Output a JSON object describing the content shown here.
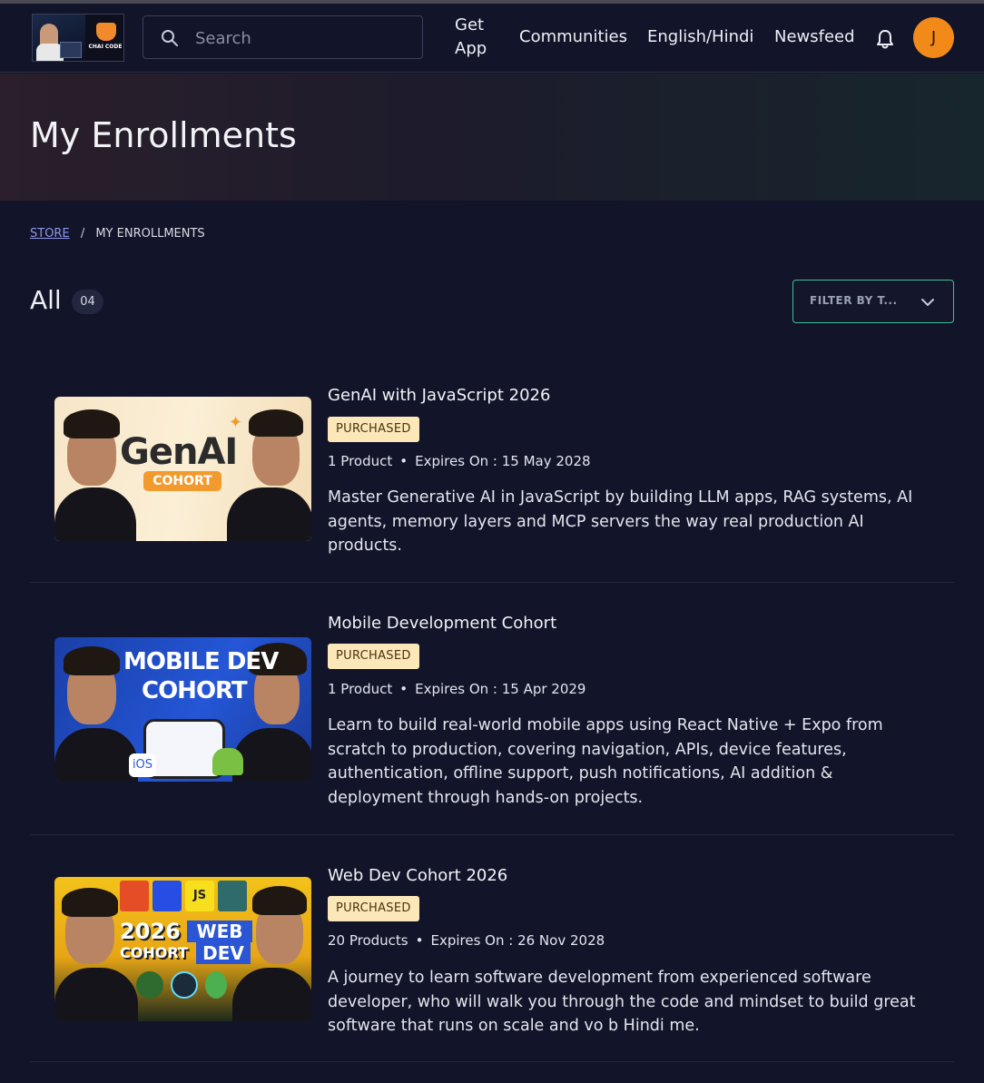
{
  "header": {
    "brand": "CHAI CODE",
    "search_placeholder": "Search",
    "nav": {
      "get_app": "Get App",
      "communities": "Communities",
      "language": "English/Hindi",
      "newsfeed": "Newsfeed"
    },
    "avatar_initial": "J"
  },
  "hero": {
    "title": "My Enrollments"
  },
  "breadcrumb": {
    "store": "STORE",
    "separator": "/",
    "current": "MY ENROLLMENTS"
  },
  "list_header": {
    "label": "All",
    "count": "04",
    "filter_label": "FILTER BY T..."
  },
  "enrollments": [
    {
      "title": "GenAI with JavaScript 2026",
      "status": "PURCHASED",
      "products": "1 Product",
      "expires": "Expires On : 15 May 2028",
      "description": "Master Generative AI in JavaScript by building LLM apps, RAG systems, AI agents, memory layers and MCP servers the way real production AI products.",
      "thumb_line1": "GenAI",
      "thumb_line2": "COHORT"
    },
    {
      "title": "Mobile Development Cohort",
      "status": "PURCHASED",
      "products": "1 Product",
      "expires": "Expires On : 15 Apr 2029",
      "description": "Learn to build real-world mobile apps using React Native + Expo from scratch to production, covering navigation, APIs, device features, authentication, offline support, push notifications, AI addition & deployment through hands-on projects.",
      "thumb_line1": "MOBILE DEV",
      "thumb_line2": "COHORT"
    },
    {
      "title": "Web Dev Cohort 2026",
      "status": "PURCHASED",
      "products": "20 Products",
      "expires": "Expires On : 26 Nov 2028",
      "description": "A journey to learn software development from experienced software developer, who will walk you through the code and mindset to build great software that runs on scale and vo b Hindi me.",
      "thumb_line1": "2026",
      "thumb_line2": "COHORT",
      "thumb_line3": "WEB",
      "thumb_line4": "DEV"
    }
  ],
  "colors": {
    "background": "#12142a",
    "avatar": "#f28a1a",
    "filter_border": "#3fbf8f",
    "status_bg": "#fbe7b8",
    "link": "#8f95e6"
  }
}
